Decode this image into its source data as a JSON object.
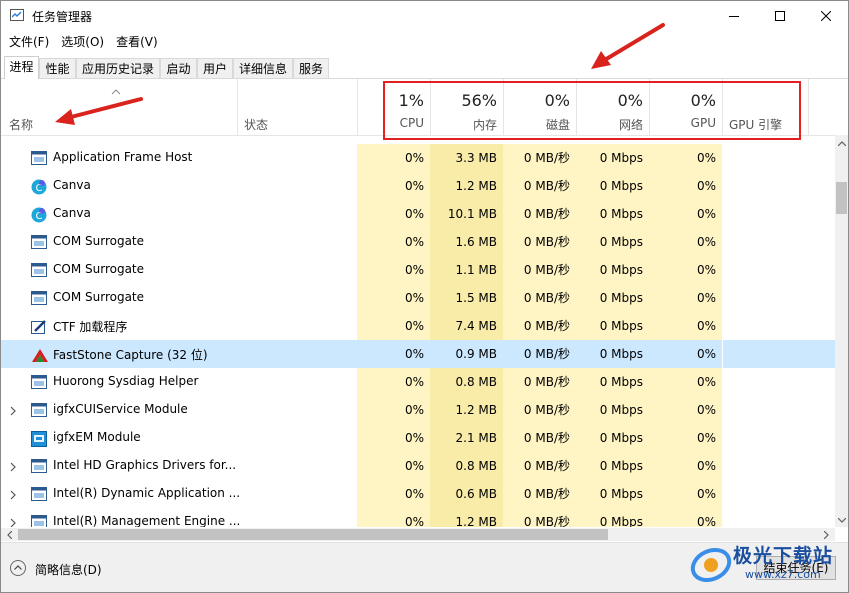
{
  "window": {
    "title": "任务管理器"
  },
  "menu": [
    "文件(F)",
    "选项(O)",
    "查看(V)"
  ],
  "tabs": [
    "进程",
    "性能",
    "应用历史记录",
    "启动",
    "用户",
    "详细信息",
    "服务"
  ],
  "active_tab": "进程",
  "columns": {
    "name": "名称",
    "status": "状态",
    "cpu": {
      "pct": "1%",
      "label": "CPU"
    },
    "memory": {
      "pct": "56%",
      "label": "内存"
    },
    "disk": {
      "pct": "0%",
      "label": "磁盘"
    },
    "network": {
      "pct": "0%",
      "label": "网络"
    },
    "gpu": {
      "pct": "0%",
      "label": "GPU"
    },
    "gpu_engine": "GPU 引擎"
  },
  "processes": [
    {
      "name": "Application Frame Host",
      "icon": "app-window-icon",
      "expand": false,
      "cpu": "0%",
      "mem": "3.3 MB",
      "disk": "0 MB/秒",
      "net": "0 Mbps",
      "gpu": "0%"
    },
    {
      "name": "Canva",
      "icon": "canva-icon",
      "expand": false,
      "cpu": "0%",
      "mem": "1.2 MB",
      "disk": "0 MB/秒",
      "net": "0 Mbps",
      "gpu": "0%"
    },
    {
      "name": "Canva",
      "icon": "canva-icon",
      "expand": false,
      "cpu": "0%",
      "mem": "10.1 MB",
      "disk": "0 MB/秒",
      "net": "0 Mbps",
      "gpu": "0%"
    },
    {
      "name": "COM Surrogate",
      "icon": "app-window-icon",
      "expand": false,
      "cpu": "0%",
      "mem": "1.6 MB",
      "disk": "0 MB/秒",
      "net": "0 Mbps",
      "gpu": "0%"
    },
    {
      "name": "COM Surrogate",
      "icon": "app-window-icon",
      "expand": false,
      "cpu": "0%",
      "mem": "1.1 MB",
      "disk": "0 MB/秒",
      "net": "0 Mbps",
      "gpu": "0%"
    },
    {
      "name": "COM Surrogate",
      "icon": "app-window-icon",
      "expand": false,
      "cpu": "0%",
      "mem": "1.5 MB",
      "disk": "0 MB/秒",
      "net": "0 Mbps",
      "gpu": "0%"
    },
    {
      "name": "CTF 加载程序",
      "icon": "ctf-pen-icon",
      "expand": false,
      "cpu": "0%",
      "mem": "7.4 MB",
      "disk": "0 MB/秒",
      "net": "0 Mbps",
      "gpu": "0%"
    },
    {
      "name": "FastStone Capture (32 位)",
      "icon": "faststone-icon",
      "expand": false,
      "selected": true,
      "cpu": "0%",
      "mem": "0.9 MB",
      "disk": "0 MB/秒",
      "net": "0 Mbps",
      "gpu": "0%"
    },
    {
      "name": "Huorong Sysdiag Helper",
      "icon": "app-window-icon",
      "expand": false,
      "cpu": "0%",
      "mem": "0.8 MB",
      "disk": "0 MB/秒",
      "net": "0 Mbps",
      "gpu": "0%"
    },
    {
      "name": "igfxCUIService Module",
      "icon": "app-window-icon",
      "expand": true,
      "cpu": "0%",
      "mem": "1.2 MB",
      "disk": "0 MB/秒",
      "net": "0 Mbps",
      "gpu": "0%"
    },
    {
      "name": "igfxEM Module",
      "icon": "intel-graphics-icon",
      "expand": false,
      "cpu": "0%",
      "mem": "2.1 MB",
      "disk": "0 MB/秒",
      "net": "0 Mbps",
      "gpu": "0%"
    },
    {
      "name": "Intel HD Graphics Drivers for...",
      "icon": "app-window-icon",
      "expand": true,
      "cpu": "0%",
      "mem": "0.8 MB",
      "disk": "0 MB/秒",
      "net": "0 Mbps",
      "gpu": "0%"
    },
    {
      "name": "Intel(R) Dynamic Application ...",
      "icon": "app-window-icon",
      "expand": true,
      "cpu": "0%",
      "mem": "0.6 MB",
      "disk": "0 MB/秒",
      "net": "0 Mbps",
      "gpu": "0%"
    },
    {
      "name": "Intel(R) Management Engine ...",
      "icon": "app-window-icon",
      "expand": true,
      "cpu": "0%",
      "mem": "1.2 MB",
      "disk": "0 MB/秒",
      "net": "0 Mbps",
      "gpu": "0%"
    }
  ],
  "footer": {
    "fewer_details": "简略信息(D)",
    "end_task": "结束任务(E)"
  },
  "watermark": {
    "text": "极光下载站",
    "url": "www.xz7.com"
  },
  "colors": {
    "selected_row": "#cce8ff",
    "cpu_mem_heat": "#fff4c4",
    "annotation_red": "#e32020"
  }
}
